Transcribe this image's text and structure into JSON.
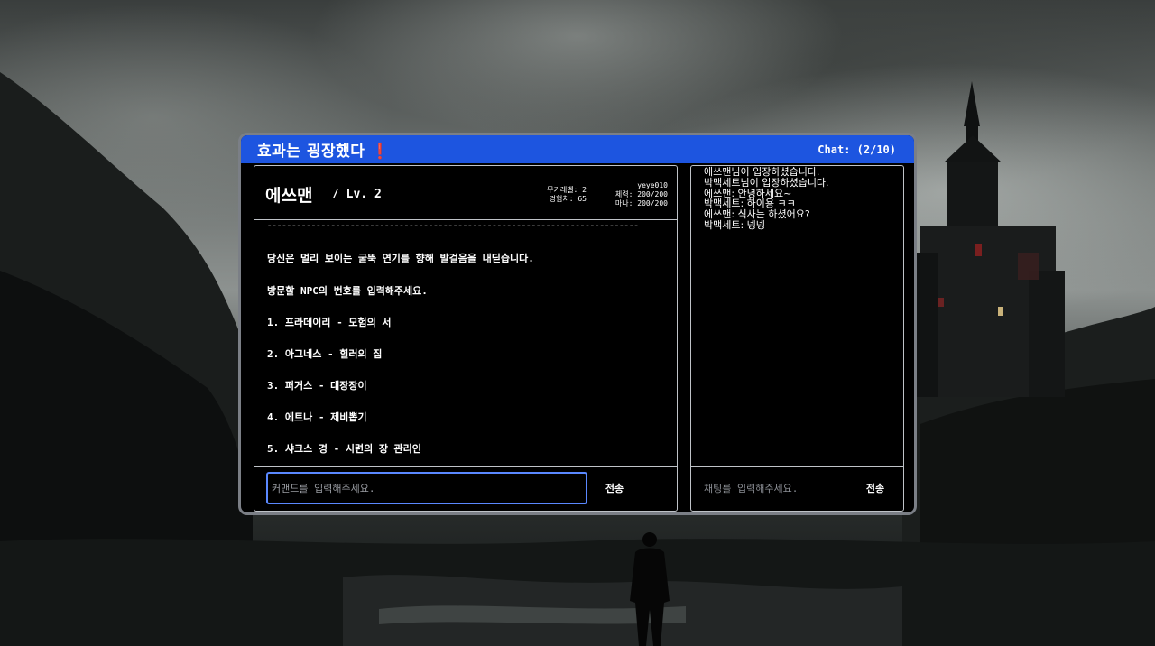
{
  "window": {
    "title": "효과는 굉장했다 ❗",
    "chat_count": "Chat: (2/10)"
  },
  "character": {
    "name": "에쓰맨",
    "level": "/ Lv. 2",
    "user_id": "yeye010",
    "weapon_level": "무기레벨: 2",
    "experience": "경험치: 65",
    "health": "체력: 200/200",
    "mana": "마나: 200/200"
  },
  "game": {
    "divider": "----------------------------------------------------------------------------",
    "messages": [
      "당신은 멀리 보이는 굴뚝 연기를 향해 발걸음을 내딛습니다.",
      "방문할 NPC의 번호를 입력해주세요.",
      "1. 프라데이리 - 모험의 서",
      "2. 아그네스 - 힐러의 집",
      "3. 퍼거스 - 대장장이",
      "4. 에트나 - 제비뽑기",
      "5. 샤크스 경 - 시련의 장 관리인"
    ],
    "command_placeholder": "커맨드를 입력해주세요.",
    "send_label": "전송"
  },
  "chat": {
    "lines": [
      "에쓰맨님이 입장하셨습니다.",
      "박맥세트님이 입장하셨습니다.",
      "에쓰맨: 안녕하세요~",
      "박맥세트: 하이용 ㅋㅋ",
      "에쓰맨: 식사는 하셨어요?",
      "박맥세트: 넹넹"
    ],
    "placeholder": "채팅를 입력해주세요.",
    "send_label": "전송"
  },
  "colors": {
    "titlebar": "#1d55e0",
    "input_focus": "#5a88ff",
    "panel_border": "#bfc3c8"
  }
}
